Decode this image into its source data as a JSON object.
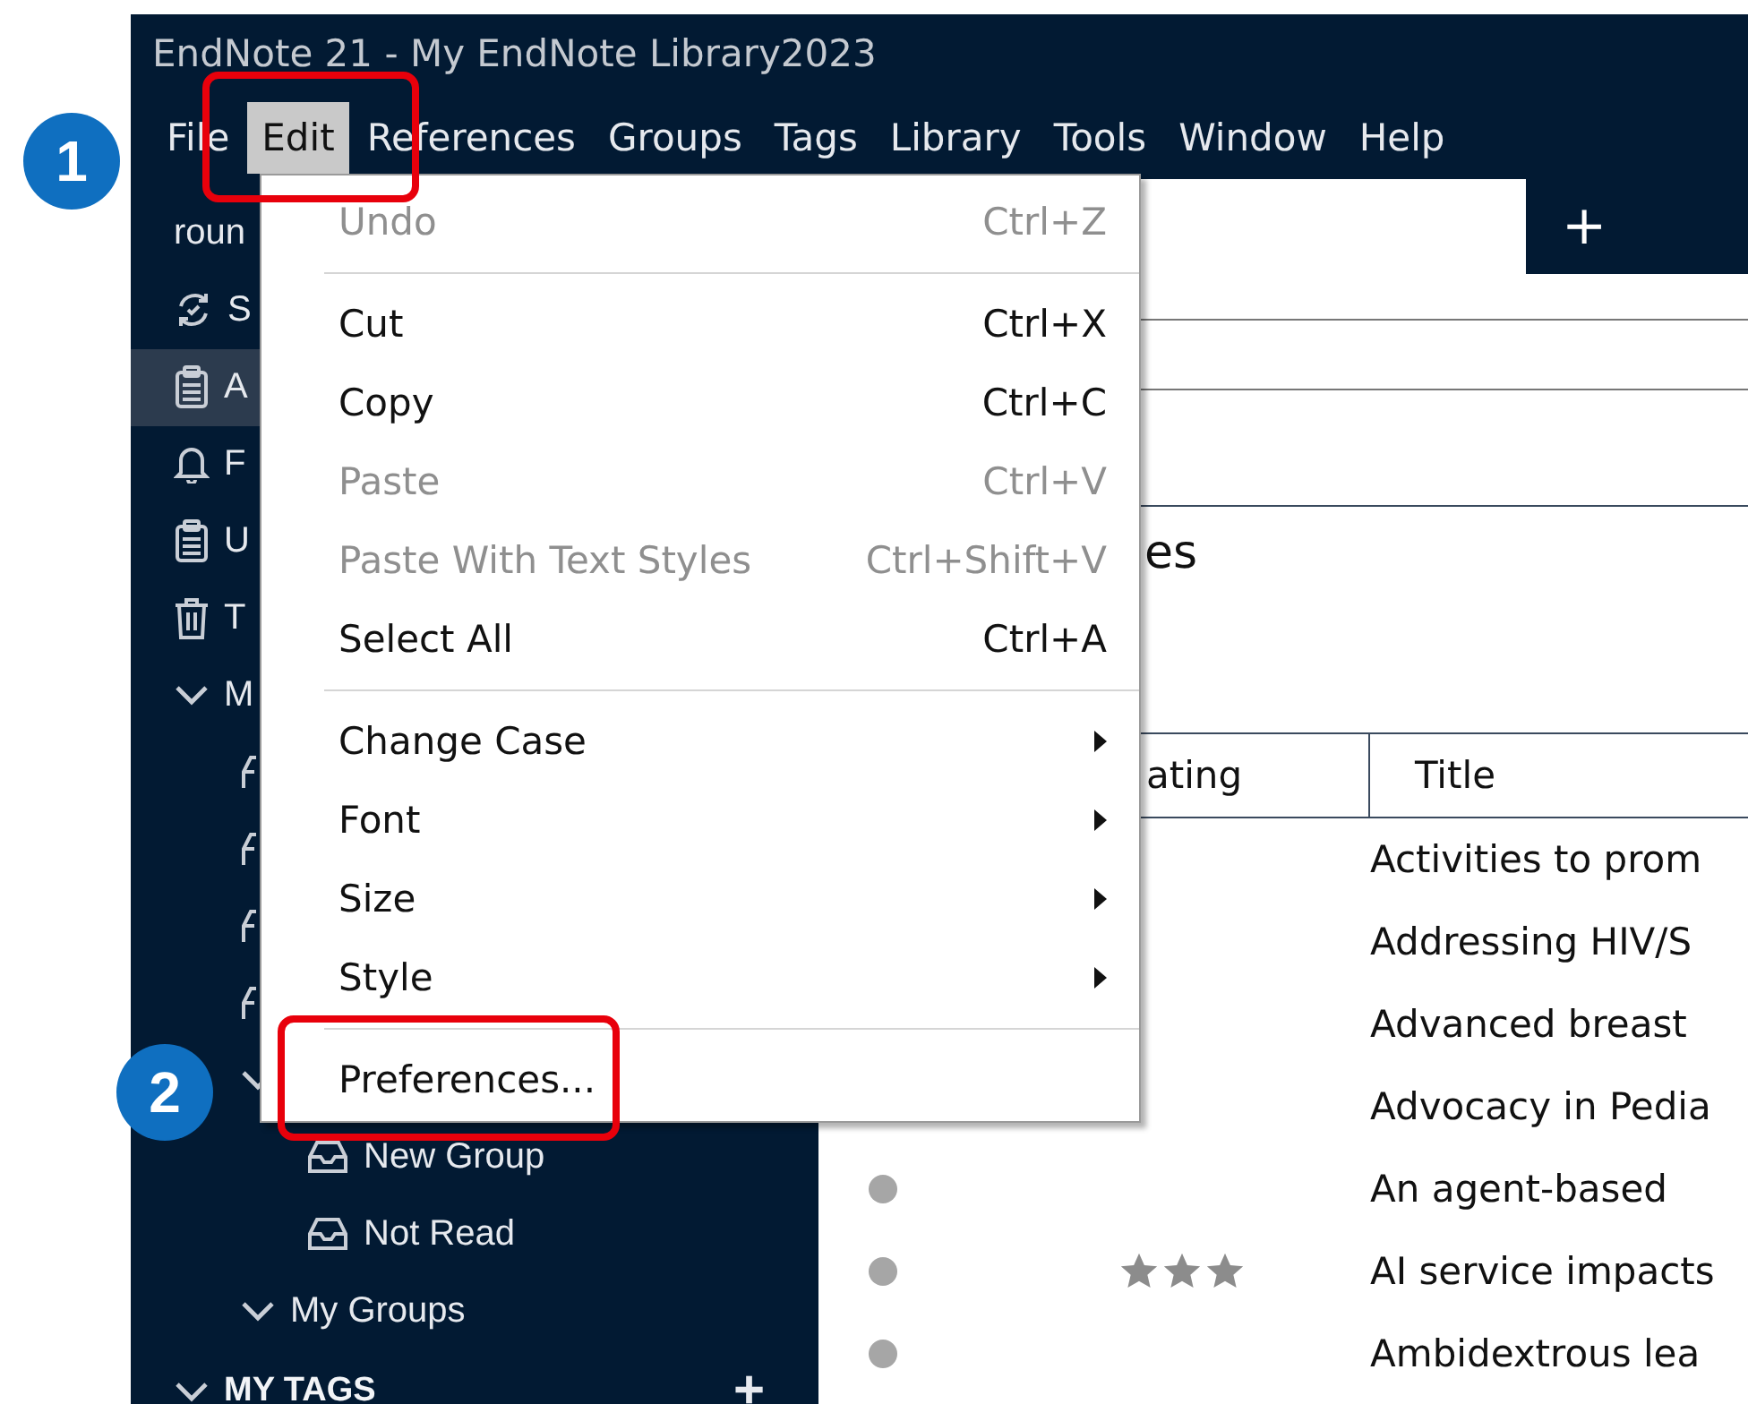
{
  "window": {
    "title": "EndNote 21 - My EndNote Library2023"
  },
  "menubar": [
    {
      "label": "File",
      "selected": false
    },
    {
      "label": "Edit",
      "selected": true
    },
    {
      "label": "References",
      "selected": false
    },
    {
      "label": "Groups",
      "selected": false
    },
    {
      "label": "Tags",
      "selected": false
    },
    {
      "label": "Library",
      "selected": false
    },
    {
      "label": "Tools",
      "selected": false
    },
    {
      "label": "Window",
      "selected": false
    },
    {
      "label": "Help",
      "selected": false
    }
  ],
  "sidebar": {
    "items": [
      {
        "kind": "text",
        "label": "roun",
        "selected": false
      },
      {
        "kind": "sync",
        "label": "S",
        "selected": false
      },
      {
        "kind": "clipboard",
        "label": "A",
        "selected": true
      },
      {
        "kind": "bell",
        "label": "F",
        "selected": false
      },
      {
        "kind": "clipboard",
        "label": "U",
        "selected": false
      },
      {
        "kind": "trash",
        "label": "T",
        "selected": false
      },
      {
        "kind": "folder",
        "label": "M",
        "selected": false,
        "expanded": true,
        "children": [
          {
            "kind": "group",
            "selected": false
          },
          {
            "kind": "group",
            "selected": false
          },
          {
            "kind": "group",
            "selected": false
          },
          {
            "kind": "group",
            "selected": false
          },
          {
            "kind": "folder",
            "selected": false,
            "expanded": true,
            "children": [
              {
                "kind": "group",
                "label": "New Group",
                "selected": false
              },
              {
                "kind": "group",
                "label": "Not Read",
                "selected": false
              }
            ]
          },
          {
            "kind": "folder",
            "label": "My Groups",
            "selected": false,
            "expanded": true
          }
        ]
      },
      {
        "kind": "heading",
        "label": "MY TAGS",
        "selected": false,
        "expanded": true,
        "action": "+"
      }
    ]
  },
  "tabs": {
    "add": "+"
  },
  "heading": "es",
  "table": {
    "columns": [
      "ating",
      "Title"
    ],
    "rows": [
      {
        "title": "Activities to prom"
      },
      {
        "title": "Addressing HIV/S"
      },
      {
        "title": "Advanced breast"
      },
      {
        "title": "Advocacy in Pedia"
      },
      {
        "dot": true,
        "title": "An agent-based"
      },
      {
        "dot": true,
        "stars": 3,
        "title": "AI service impacts"
      },
      {
        "dot": true,
        "title": "Ambidextrous lea"
      }
    ]
  },
  "edit_menu": [
    {
      "kind": "item",
      "label": "Undo",
      "shortcut": "Ctrl+Z",
      "disabled": true
    },
    {
      "kind": "separator"
    },
    {
      "kind": "item",
      "label": "Cut",
      "shortcut": "Ctrl+X",
      "disabled": false
    },
    {
      "kind": "item",
      "label": "Copy",
      "shortcut": "Ctrl+C",
      "disabled": false
    },
    {
      "kind": "item",
      "label": "Paste",
      "shortcut": "Ctrl+V",
      "disabled": true
    },
    {
      "kind": "item",
      "label": "Paste With Text Styles",
      "shortcut": "Ctrl+Shift+V",
      "disabled": true
    },
    {
      "kind": "item",
      "label": "Select All",
      "shortcut": "Ctrl+A",
      "disabled": false
    },
    {
      "kind": "separator"
    },
    {
      "kind": "submenu",
      "label": "Change Case",
      "disabled": false
    },
    {
      "kind": "submenu",
      "label": "Font",
      "disabled": false
    },
    {
      "kind": "submenu",
      "label": "Size",
      "disabled": false
    },
    {
      "kind": "submenu",
      "label": "Style",
      "disabled": false
    },
    {
      "kind": "separator"
    },
    {
      "kind": "item",
      "label": "Preferences...",
      "disabled": false
    }
  ],
  "callouts": [
    {
      "number": "1"
    },
    {
      "number": "2"
    }
  ]
}
